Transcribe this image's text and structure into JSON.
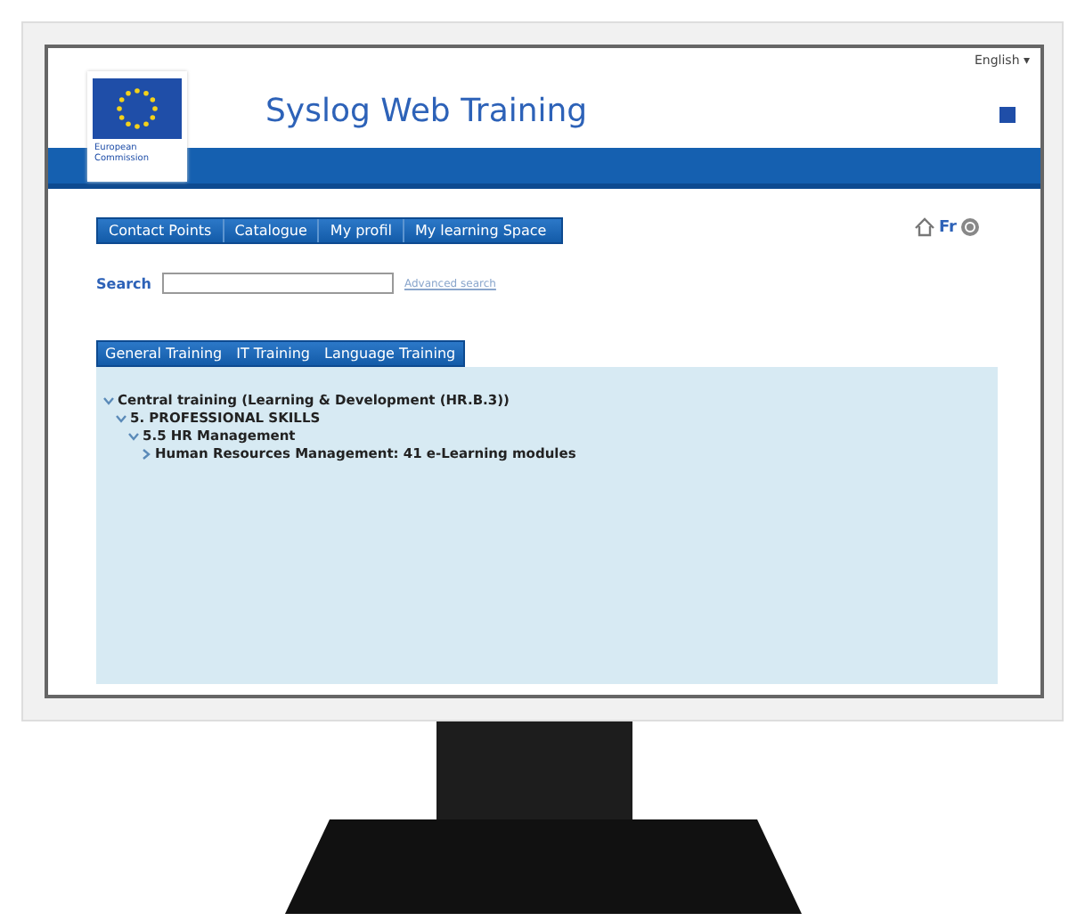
{
  "language_menu": {
    "label": "English ▾"
  },
  "header": {
    "logo_caption": "European Commission",
    "title": "Syslog Web Training"
  },
  "nav": [
    {
      "label": "Contact Points"
    },
    {
      "label": "Catalogue"
    },
    {
      "label": "My profil"
    },
    {
      "label": "My learning Space"
    }
  ],
  "top_right": {
    "language_link": "Fr"
  },
  "search": {
    "label": "Search",
    "link": "Advanced search"
  },
  "training_tabs": [
    {
      "label": "General Training"
    },
    {
      "label": "IT Training"
    },
    {
      "label": "Language Training"
    }
  ],
  "tree": [
    {
      "label": "Central training (Learning & Development (HR.B.3))",
      "expanded": true,
      "children": [
        {
          "label": "5. PROFESSIONAL SKILLS",
          "expanded": true,
          "children": [
            {
              "label": "5.5 HR Management",
              "expanded": true,
              "children": [
                {
                  "label": "Human Resources Management: 41 e-Learning modules",
                  "expanded": false
                }
              ]
            }
          ]
        }
      ]
    }
  ]
}
